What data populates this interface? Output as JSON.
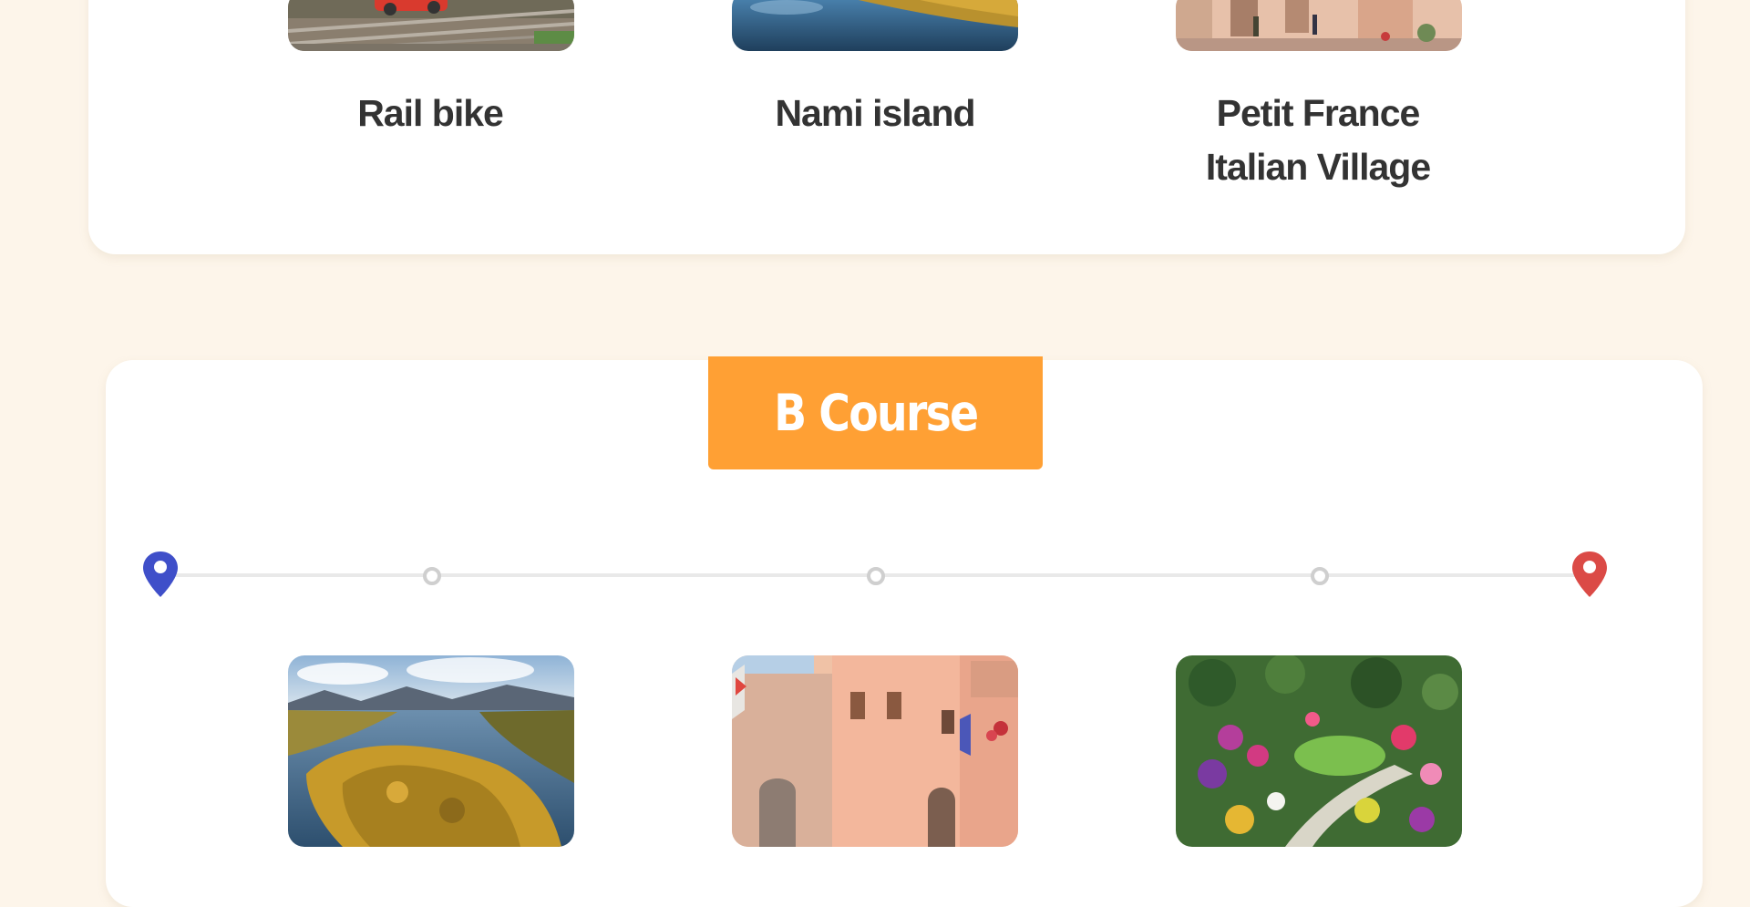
{
  "course_a": {
    "stops": [
      {
        "name_line1": "Rail bike",
        "name_line2": ""
      },
      {
        "name_line1": "Nami island",
        "name_line2": ""
      },
      {
        "name_line1": "Petit France",
        "name_line2": "Italian Village"
      }
    ]
  },
  "course_b": {
    "title": "B Course",
    "timeline": {
      "start_icon": "map-pin-start-icon",
      "end_icon": "map-pin-end-icon",
      "start_color": "#3f4fc9",
      "end_color": "#db4a46",
      "waypoint_count": 3
    },
    "stops": [
      {
        "image": "nami-island-aerial-photo"
      },
      {
        "image": "italian-village-street-photo"
      },
      {
        "image": "flower-garden-aerial-photo"
      }
    ]
  },
  "colors": {
    "page_bg": "#fdf5ea",
    "card_bg": "#ffffff",
    "accent": "#ffa034",
    "text": "#333333"
  }
}
